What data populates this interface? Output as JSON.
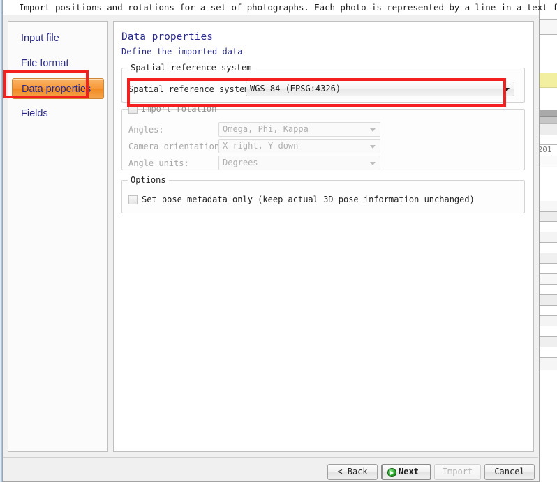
{
  "window": {
    "header_text": "Import positions and rotations for a set of photographs. Each photo is represented by a line in a text file."
  },
  "sidebar": {
    "items": [
      {
        "label": "Input file",
        "selected": false
      },
      {
        "label": "File format",
        "selected": false
      },
      {
        "label": "Data properties",
        "selected": true
      },
      {
        "label": "Fields",
        "selected": false
      }
    ]
  },
  "main": {
    "title": "Data properties",
    "subtitle": "Define the imported data",
    "srs_group": {
      "legend": "Spatial reference system",
      "field_label": "Spatial reference system:",
      "value": "WGS 84 (EPSG:4326)"
    },
    "rotation_group": {
      "legend": "Import rotation",
      "checked": false,
      "fields": [
        {
          "label": "Angles:",
          "value": "Omega, Phi, Kappa"
        },
        {
          "label": "Camera orientation:",
          "value": "X right, Y down"
        },
        {
          "label": "Angle units:",
          "value": "Degrees"
        }
      ]
    },
    "options_group": {
      "legend": "Options",
      "checkbox_label": "Set pose metadata only (keep actual 3D pose information unchanged)",
      "checked": false
    }
  },
  "footer": {
    "back_label": "< Back",
    "next_label": "Next",
    "import_label": "Import",
    "cancel_label": "Cancel"
  },
  "background": {
    "cell_text": "/201"
  },
  "colors": {
    "accent_orange": "#f08a22",
    "annotation_red": "#f42020",
    "heading_navy": "#2a2a8c",
    "highlight_yellow": "#f2f0a0"
  }
}
